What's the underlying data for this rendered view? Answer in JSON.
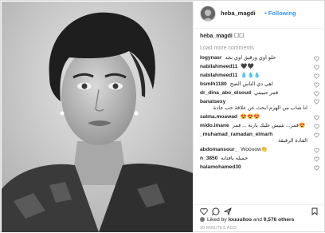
{
  "post": {
    "username": "heba_magdi",
    "follow_separator": "•",
    "follow_label": "Following",
    "caption_user": "heba_magdi",
    "caption_text": "☐☐"
  },
  "load_more": "Load more comments",
  "comments": [
    {
      "user": "logynasr",
      "text": "حلو اوي ورقيق اوي بجد",
      "inline": true
    },
    {
      "user": "nabilahmeed11",
      "text": "🖤🖤",
      "inline": true
    },
    {
      "user": "nabilahmeed11",
      "text": "💧💧💧",
      "inline": true
    },
    {
      "user": "bsmlh1180",
      "text": "اهي دي الناس الصح",
      "inline": true
    },
    {
      "user": "dr_dina_abo_elsoud",
      "text": "قمر حبيبتي",
      "inline": true
    },
    {
      "user": "banatsexy",
      "text": "انا شاب من الهرم ابحث عن علاقة حب جادة",
      "inline": false
    },
    {
      "user": "salma.moawad",
      "text": "😍😍😍",
      "inline": true
    },
    {
      "user": "mido.imane",
      "text": "قمر... شيش عليك بارنة ... قمر😍",
      "inline": true
    },
    {
      "user": "_muhamad_ramadan_elmarh",
      "text": "القادة الرقيقة",
      "inline": false
    },
    {
      "user": "abdomansour_",
      "text": "Woooow👏",
      "inline": true
    },
    {
      "user": "n_3850",
      "text": "جميله يافنانه",
      "inline": true
    },
    {
      "user": "halamohamed30",
      "text": "",
      "inline": true
    }
  ],
  "likes": {
    "prefix": "Liked by",
    "user": "louuulloo",
    "conj": "and",
    "count": "9,576 others"
  },
  "timestamp": "30 MINUTES AGO",
  "colors": {
    "link": "#3897f0",
    "muted": "#999999",
    "border": "#efefef"
  }
}
